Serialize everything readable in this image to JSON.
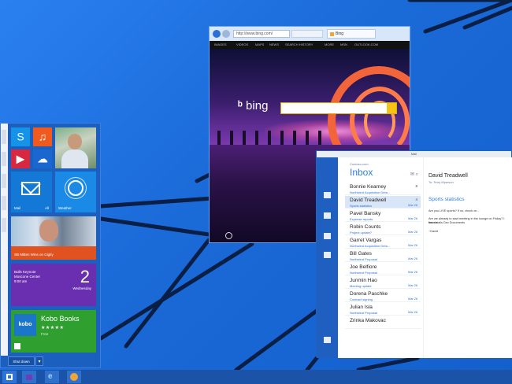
{
  "start_menu": {
    "tiles": {
      "mail_label": "Mail",
      "all_label": "All",
      "weather_label": "Weather",
      "sports_caption": "SB Mitten Wins on Gigity",
      "calendar_event": "Bulls Keynote",
      "calendar_sub": "Moscone Center",
      "calendar_time": "9:00 am",
      "calendar_day": "2",
      "calendar_dow": "Wednesday",
      "kobo_logo": "kobo",
      "kobo_name": "Kobo Books",
      "kobo_stars": "★★★★★",
      "kobo_meta": "Free"
    },
    "shutdown_label": "Shut down",
    "shutdown_arrow": "▾"
  },
  "browser": {
    "address": "http://www.bing.com/",
    "tab_title": "Bing",
    "menu_items": [
      "IMAGES",
      "VIDEOS",
      "MAPS",
      "NEWS",
      "SEARCH HISTORY",
      "MORE",
      "MSN",
      "OUTLOOK.COM"
    ],
    "logo": "bing"
  },
  "mail": {
    "window_title": "Mail",
    "account": "Contoso.com",
    "folder": "Inbox",
    "tools": "✉ ⌕",
    "messages": [
      {
        "from": "Bonnie Kearney",
        "subject": "Northwind Acquisition Deta...",
        "date": "Mar 26",
        "count": "8"
      },
      {
        "from": "David Treadwell",
        "subject": "Sports statistics",
        "date": "Mar 26",
        "count": "4"
      },
      {
        "from": "Pavel Bansky",
        "subject": "Expense reports",
        "date": "Mar 26",
        "count": ""
      },
      {
        "from": "Robin Counts",
        "subject": "Project update?",
        "date": "Mar 26",
        "count": ""
      },
      {
        "from": "Garret Vargas",
        "subject": "Northwind Acquisition Deta...",
        "date": "Mar 26",
        "count": ""
      },
      {
        "from": "Bill Gates",
        "subject": "Northwind Proposal",
        "date": "Mar 26",
        "count": ""
      },
      {
        "from": "Joe Belfiore",
        "subject": "Northwind Proposal",
        "date": "Mar 26",
        "count": ""
      },
      {
        "from": "Junmin Hao",
        "subject": "Meeting update",
        "date": "Mar 26",
        "count": ""
      },
      {
        "from": "Dorena Paschke",
        "subject": "Contract signing",
        "date": "Mar 26",
        "count": ""
      },
      {
        "from": "Julian Isla",
        "subject": "Northwind Proposal",
        "date": "Mar 26",
        "count": ""
      },
      {
        "from": "Zrinka Makovac",
        "subject": "",
        "date": "",
        "count": ""
      }
    ],
    "reading": {
      "from": "David Treadwell",
      "to": "To: Terry Myerson",
      "subject": "Sports statistics",
      "body_lines": [
        "Are you LIVE sports? If so, check on...",
        "Are we already to start meeting in the lounge on Friday? I have a",
        "few details Dec Documents",
        "~David"
      ]
    }
  }
}
